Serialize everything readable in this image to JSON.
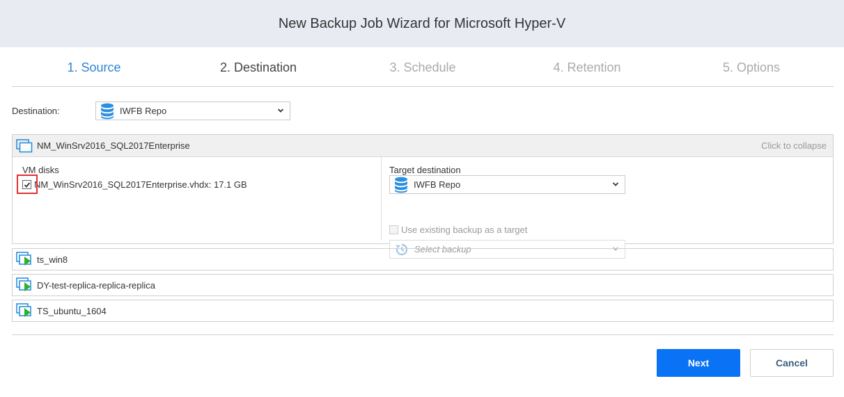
{
  "window": {
    "title": "New Backup Job Wizard for Microsoft Hyper-V"
  },
  "steps": [
    {
      "label": "1. Source",
      "state": "done"
    },
    {
      "label": "2. Destination",
      "state": "active"
    },
    {
      "label": "3. Schedule",
      "state": "pending"
    },
    {
      "label": "4. Retention",
      "state": "pending"
    },
    {
      "label": "5. Options",
      "state": "pending"
    }
  ],
  "destination": {
    "label": "Destination:",
    "value": "IWFB Repo",
    "icon": "database-icon"
  },
  "vm_expanded": {
    "name": "NM_WinSrv2016_SQL2017Enterprise",
    "collapse_label": "Click to collapse",
    "disks_label": "VM disks",
    "disk": {
      "label": "NM_WinSrv2016_SQL2017Enterprise.vhdx: 17.1 GB",
      "checked": true
    },
    "target_label": "Target destination",
    "target_value": "IWFB Repo",
    "use_existing_label": "Use existing backup as a target",
    "select_backup_placeholder": "Select backup"
  },
  "vms": [
    {
      "name": "ts_win8"
    },
    {
      "name": "DY-test-replica-replica-replica"
    },
    {
      "name": "TS_ubuntu_1604"
    }
  ],
  "buttons": {
    "next": "Next",
    "cancel": "Cancel"
  },
  "colors": {
    "accent": "#0a72f5",
    "step_done": "#2e86d4",
    "db_icon": "#2a8fe0",
    "vm_running": "#2fb030",
    "highlight": "#e03030"
  }
}
